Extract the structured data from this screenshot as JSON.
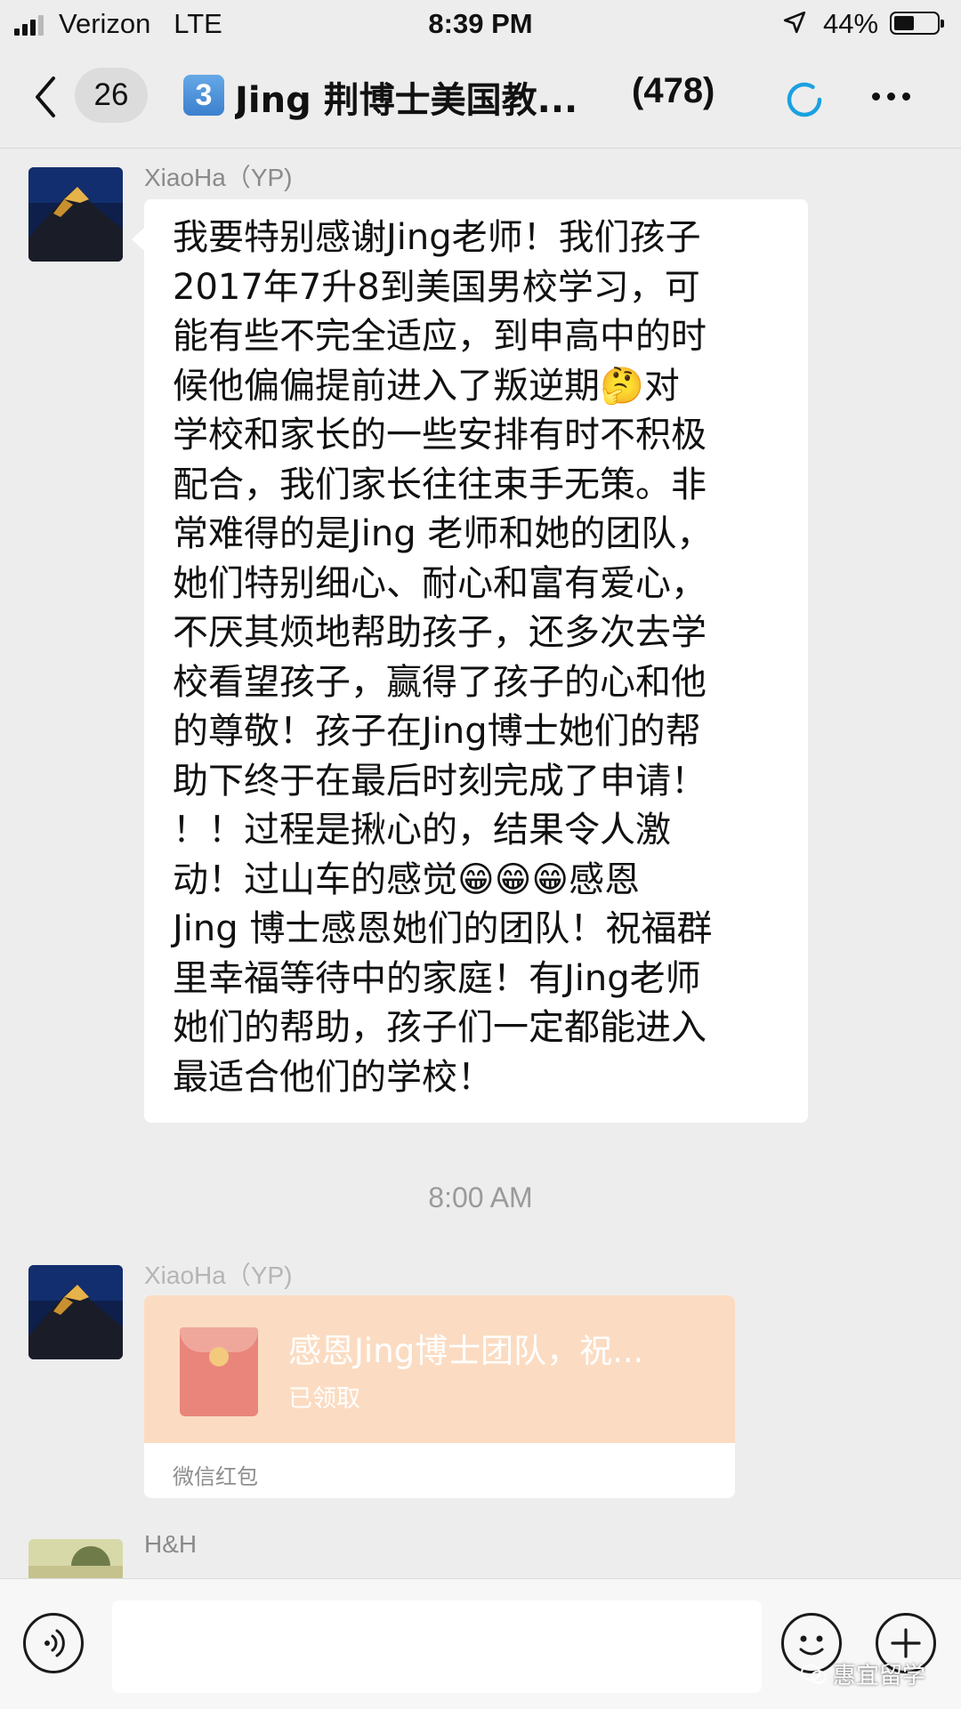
{
  "status_bar": {
    "carrier": "Verizon",
    "network": "LTE",
    "time": "8:39 PM",
    "battery": "44%",
    "battery_level": 0.44
  },
  "nav": {
    "back_count": "26",
    "group_number": "3",
    "title": "Jing 荆博士美国教...",
    "member_count": "(478)",
    "icons": [
      "back-chevron-icon",
      "loading-spinner-icon",
      "more-options-icon"
    ]
  },
  "messages": [
    {
      "sender": "XiaoHa（YP)",
      "lines": [
        "我要特别感谢Jing老师！我们孩子",
        "2017年7升8到美国男校学习，可",
        "能有些不完全适应，到申高中的时",
        "候他偏偏提前进入了叛逆期🤔对",
        "学校和家长的一些安排有时不积极",
        "配合，我们家长往往束手无策。非",
        "常难得的是Jing 老师和她的团队，",
        "她们特别细心、耐心和富有爱心，",
        "不厌其烦地帮助孩子，还多次去学",
        "校看望孩子，赢得了孩子的心和他",
        "的尊敬！孩子在Jing博士她们的帮",
        "助下终于在最后时刻完成了申请！",
        "！！过程是揪心的，结果令人激",
        "动！过山车的感觉😁😁😁感恩",
        "Jing 博士感恩她们的团队！祝福群",
        "里幸福等待中的家庭！有Jing老师",
        "她们的帮助，孩子们一定都能进入",
        "最适合他们的学校！"
      ]
    },
    {
      "sender": "XiaoHa（YP)",
      "red_packet": {
        "title": "感恩Jing博士团队，祝...",
        "status": "已领取",
        "label": "微信红包"
      }
    },
    {
      "sender": "H&H"
    }
  ],
  "timestamp": "8:00 AM",
  "input": {
    "placeholder": ""
  },
  "watermark": "惠宜留学",
  "colors": {
    "background": "#ededed",
    "bubble": "#ffffff",
    "red_packet": "#fbdcc2",
    "spinner": "#1aa1e0"
  }
}
